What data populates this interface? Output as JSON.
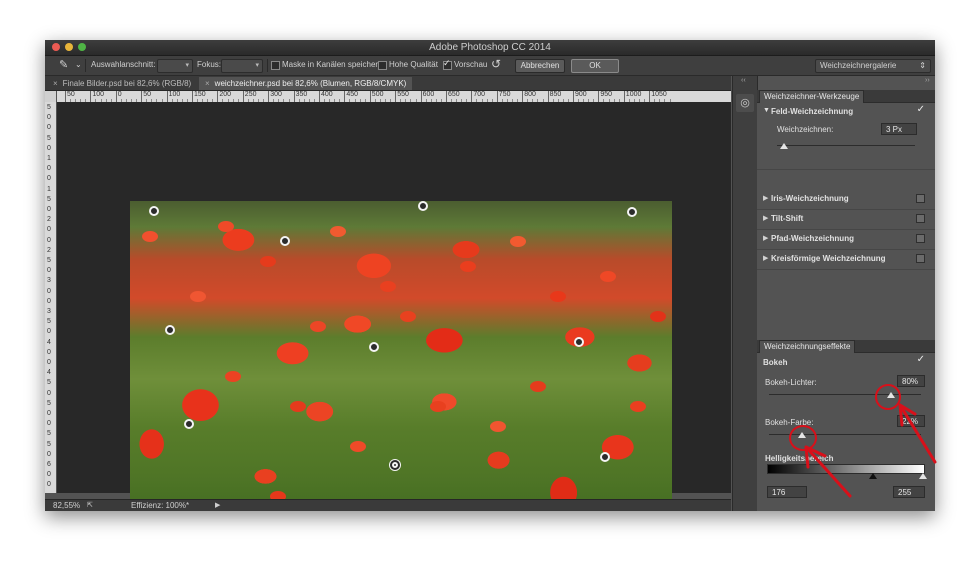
{
  "window": {
    "title": "Adobe Photoshop CC 2014"
  },
  "options_bar": {
    "selection_label": "Auswahlanschnitt:",
    "focus_label": "Fokus:",
    "mask_label": "Maske in Kanälen speichern",
    "quality_label": "Hohe Qualität",
    "preview_label": "Vorschau",
    "preview_checked": true,
    "cancel_label": "Abbrechen",
    "ok_label": "OK",
    "gallery_label": "Weichzeichnergalerie"
  },
  "tabs": [
    {
      "label": "Finale Bilder.psd bei 82,6% (RGB/8)",
      "active": false
    },
    {
      "label": "weichzeichner.psd bei 82,6% (Blumen, RGB/8/CMYK)",
      "active": true
    }
  ],
  "ruler_h": [
    "50",
    "100",
    "0",
    "50",
    "100",
    "150",
    "200",
    "250",
    "300",
    "350",
    "400",
    "450",
    "500",
    "550",
    "600",
    "650",
    "700",
    "750",
    "800",
    "850",
    "900",
    "950",
    "1000",
    "1050"
  ],
  "ruler_v": [
    "5",
    "0",
    "0",
    "5",
    "0",
    "1",
    "0",
    "0",
    "1",
    "5",
    "0",
    "2",
    "0",
    "0",
    "2",
    "5",
    "0",
    "3",
    "0",
    "0",
    "3",
    "5",
    "0",
    "4",
    "0",
    "0",
    "4",
    "5",
    "0",
    "5",
    "0",
    "0",
    "5",
    "5",
    "0",
    "6",
    "0",
    "0"
  ],
  "status": {
    "zoom": "82,55%",
    "efficiency": "Effizienz: 100%*"
  },
  "panel": {
    "tools_tab": "Weichzeichner-Werkzeuge",
    "field_blur": {
      "label": "Feld-Weichzeichnung",
      "checked": true,
      "amount_label": "Weichzeichnen:",
      "amount_value": "3 Px",
      "amount_fraction": 0.05
    },
    "others": [
      {
        "label": "Iris-Weichzeichnung",
        "checked": false
      },
      {
        "label": "Tilt-Shift",
        "checked": false
      },
      {
        "label": "Pfad-Weichzeichnung",
        "checked": false
      },
      {
        "label": "Kreisförmige Weichzeichnung",
        "checked": false
      }
    ],
    "effects_tab": "Weichzeichnungseffekte",
    "bokeh": {
      "label": "Bokeh",
      "checked": true
    },
    "bokeh_light": {
      "label": "Bokeh-Lichter:",
      "value": "80%",
      "fraction": 0.8
    },
    "bokeh_color": {
      "label": "Bokeh-Farbe:",
      "value": "22%",
      "fraction": 0.22
    },
    "brightness": {
      "label": "Helligkeitsbereich",
      "low": "176",
      "high": "255"
    }
  },
  "colors": {
    "annotation": "#d8101a",
    "panel": "#535353",
    "canvas": "#282828"
  },
  "icons": [
    "pin-tool-icon",
    "undo-icon",
    "blur-gallery-dock-icon"
  ]
}
